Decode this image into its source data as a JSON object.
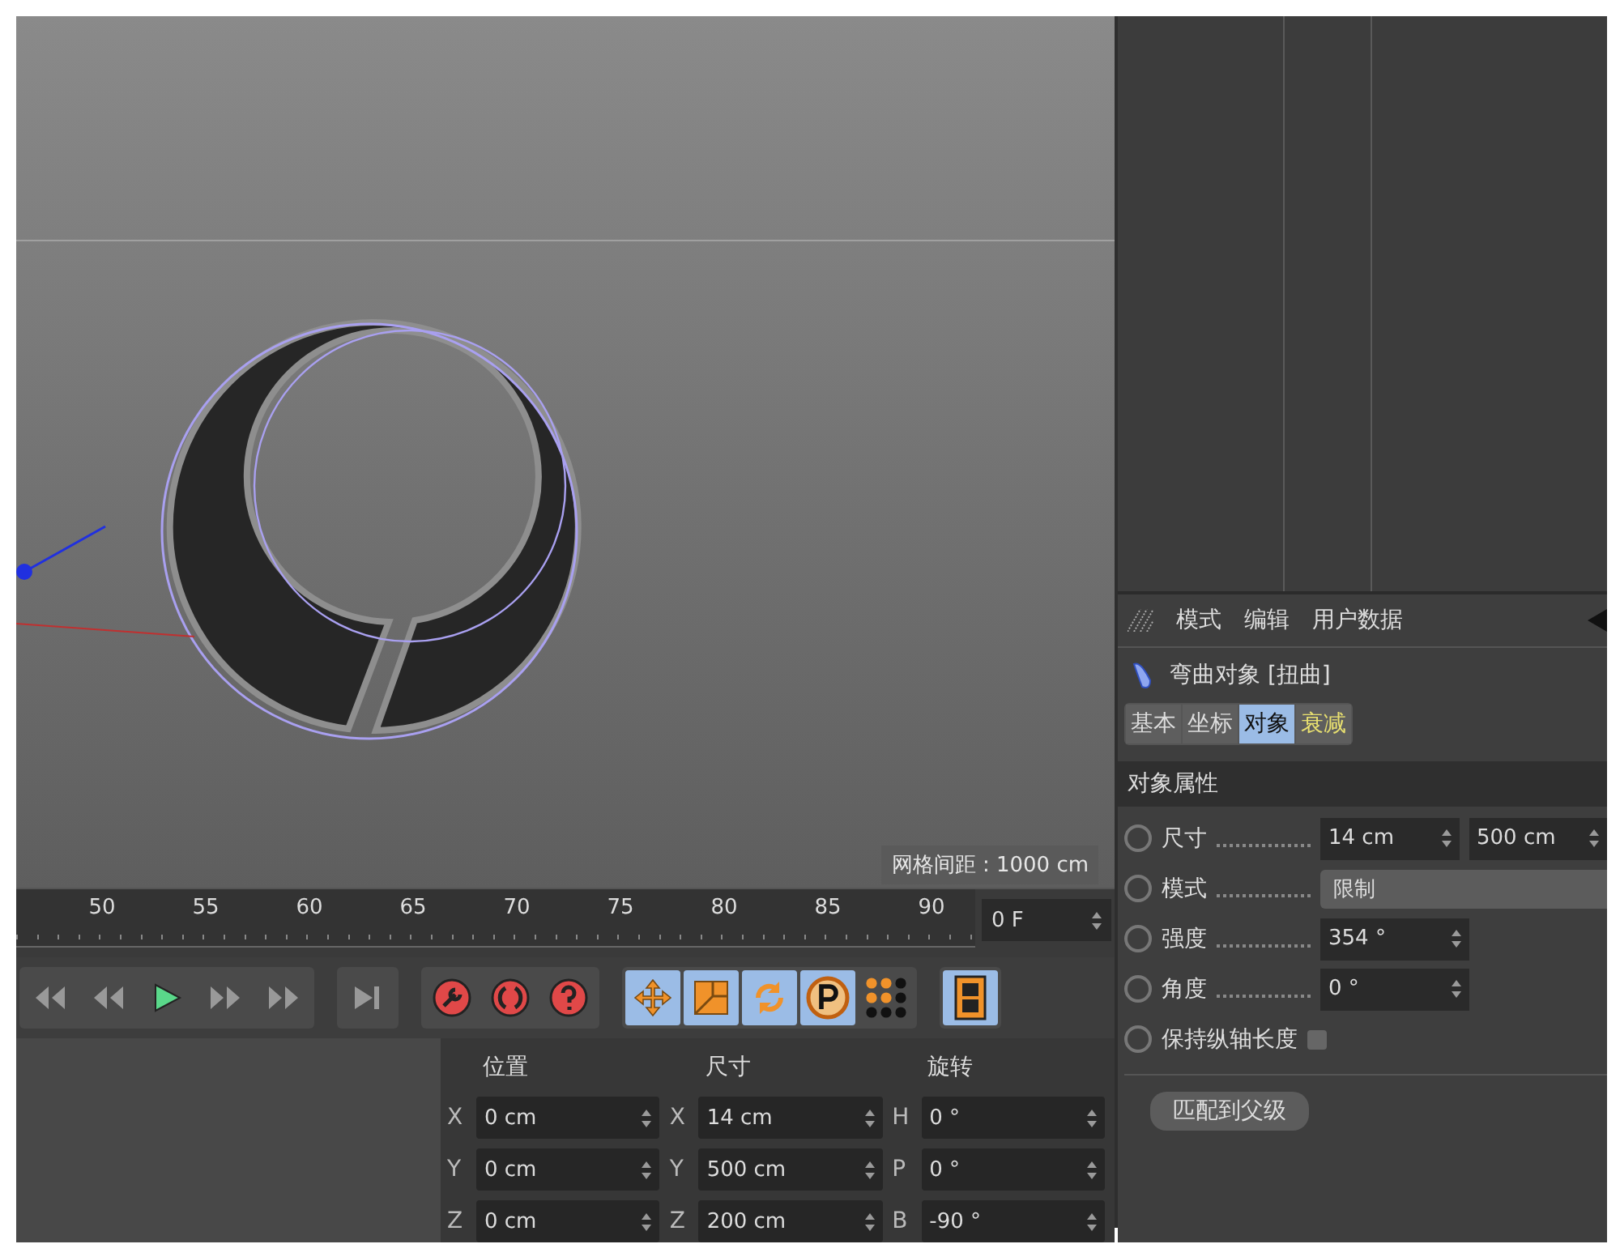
{
  "viewport": {
    "grid_label": "网格间距 : 1000 cm"
  },
  "timeline": {
    "ticks": [
      "50",
      "55",
      "60",
      "65",
      "70",
      "75",
      "80",
      "85",
      "90"
    ],
    "frame_field": "0 F"
  },
  "coordinates": {
    "columns": [
      {
        "header": "位置",
        "fields": [
          {
            "axis": "X",
            "value": "0 cm"
          },
          {
            "axis": "Y",
            "value": "0 cm"
          },
          {
            "axis": "Z",
            "value": "0 cm"
          }
        ]
      },
      {
        "header": "尺寸",
        "fields": [
          {
            "axis": "X",
            "value": "14 cm"
          },
          {
            "axis": "Y",
            "value": "500 cm"
          },
          {
            "axis": "Z",
            "value": "200 cm"
          }
        ]
      },
      {
        "header": "旋转",
        "fields": [
          {
            "axis": "H",
            "value": "0 °"
          },
          {
            "axis": "P",
            "value": "0 °"
          },
          {
            "axis": "B",
            "value": "-90 °"
          }
        ]
      }
    ]
  },
  "attributes": {
    "menu": [
      "模式",
      "编辑",
      "用户数据"
    ],
    "object_title": "弯曲对象 [扭曲]",
    "tabs": [
      {
        "label": "基本",
        "selected": false,
        "highlighted": false
      },
      {
        "label": "坐标",
        "selected": false,
        "highlighted": false
      },
      {
        "label": "对象",
        "selected": true,
        "highlighted": false
      },
      {
        "label": "衰减",
        "selected": false,
        "highlighted": true
      }
    ],
    "section": "对象属性",
    "properties": [
      {
        "kind": "pair",
        "label": "尺寸",
        "values": [
          "14 cm",
          "500 cm"
        ],
        "keyframed": false
      },
      {
        "kind": "dropdown",
        "label": "模式",
        "value": "限制",
        "keyframed": false
      },
      {
        "kind": "number",
        "label": "强度",
        "value": "354 °",
        "keyframed": false
      },
      {
        "kind": "number",
        "label": "角度",
        "value": "0 °",
        "keyframed": false
      },
      {
        "kind": "checkbox",
        "label": "保持纵轴长度",
        "checked": false,
        "keyframed": false
      }
    ],
    "button": "匹配到父级"
  }
}
